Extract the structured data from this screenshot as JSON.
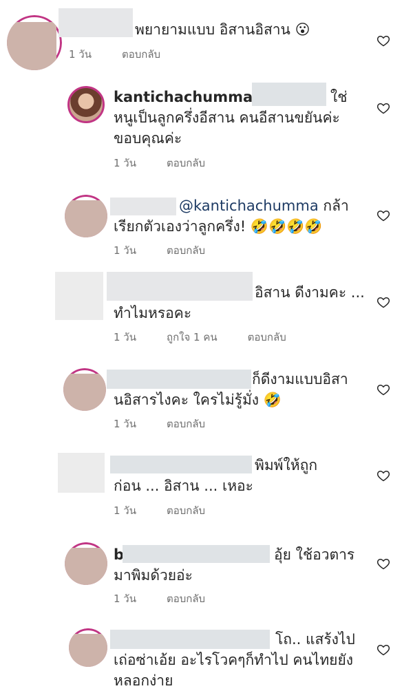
{
  "comments": [
    {
      "text": "พยายามแบบ อิสานอิสาน 😮",
      "time": "1 วัน",
      "reply": "ตอบกลับ"
    },
    {
      "username": "kantichachumma",
      "text_line1_tail": "ใช่",
      "text_line2": "หนูเป็นลูกครึ่งอีสาน คนอีสานขยันค่ะ",
      "text_line3": "ขอบคุณค่ะ",
      "time": "1 วัน",
      "reply": "ตอบกลับ"
    },
    {
      "mention": "@kantichachumma",
      "text_line1_tail": "กล้า",
      "text_line2": "เรียกตัวเองว่าลูกครึ่ง! 🤣🤣🤣🤣",
      "time": "1 วัน",
      "reply": "ตอบกลับ"
    },
    {
      "text_line1_tail": "อิสาน ดีงามคะ ...",
      "text_line2": "ทำไมหรอคะ",
      "time": "1 วัน",
      "likes": "ถูกใจ 1 คน",
      "reply": "ตอบกลับ"
    },
    {
      "text_line1_tail": "ก็ดีงามแบบอิสา",
      "text_line2": "นอิสารไงคะ ใครไม่รู้มั่ง 🤣",
      "time": "1 วัน",
      "reply": "ตอบกลับ"
    },
    {
      "text_line1_tail": "พิมพ์ให้ถูก",
      "text_line2": "ก่อน ... อิสาน ... เหอะ",
      "time": "1 วัน",
      "reply": "ตอบกลับ"
    },
    {
      "username_initial": "b",
      "text_line1_tail": "อุ้ย ใช้อวตาร",
      "text_line2": "มาพิมด้วยอ่ะ",
      "time": "1 วัน",
      "reply": "ตอบกลับ"
    },
    {
      "text_line1_tail": "โถ.. แสร้งไป",
      "text_line2": "เถ่อซ่าเอ้ย อะไรโวคๆก็ทำไป คนไทยยัง",
      "text_line3": "หลอกง่าย"
    }
  ],
  "icons": {
    "heart": "heart-outline-icon",
    "verified": "verified-badge-icon"
  }
}
